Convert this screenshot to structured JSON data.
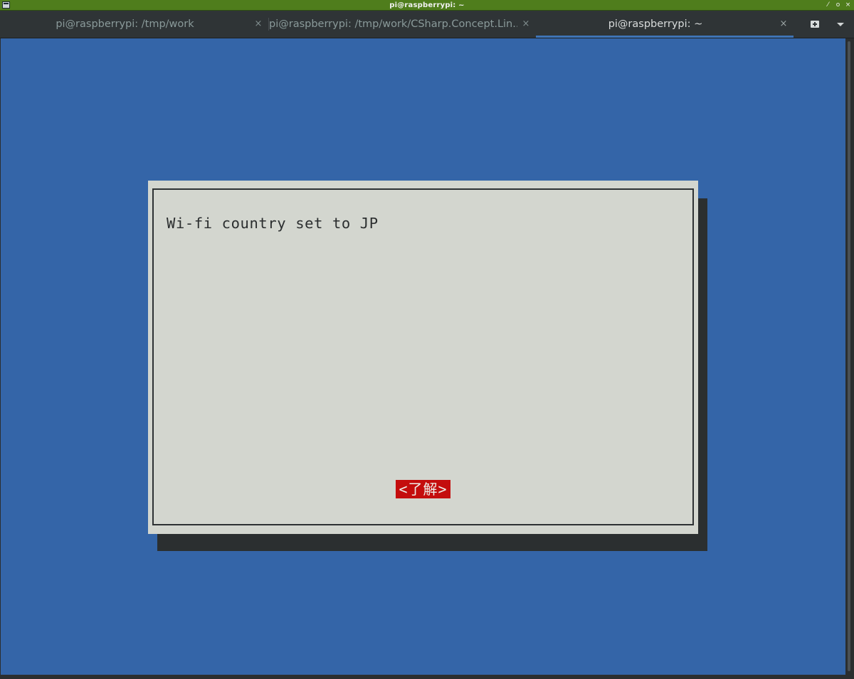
{
  "window": {
    "title": "pi@raspberrypi: ~",
    "controls": {
      "minimize": "⁄",
      "maximize": "o",
      "close": "×"
    }
  },
  "tabs": [
    {
      "label": "pi@raspberrypi: /tmp/work",
      "close": "×",
      "active": false
    },
    {
      "label": "pi@raspberrypi: /tmp/work/CSharp.Concept.Lin...",
      "close": "×",
      "active": false
    },
    {
      "label": "pi@raspberrypi: ~",
      "close": "×",
      "active": true
    }
  ],
  "toolbar": {
    "new_tab_icon": "new-tab-icon",
    "menu_icon": "dropdown-arrow-icon"
  },
  "dialog": {
    "message": "Wi-fi country set to JP",
    "ok_label": "<了解>"
  },
  "colors": {
    "titlebar": "#4f7d1c",
    "terminal_bg": "#3465a8",
    "dialog_bg": "#d3d6cf",
    "dialog_shadow": "#2b2f30",
    "button_bg": "#c40d0d",
    "active_tab_underline": "#3f74b6"
  }
}
